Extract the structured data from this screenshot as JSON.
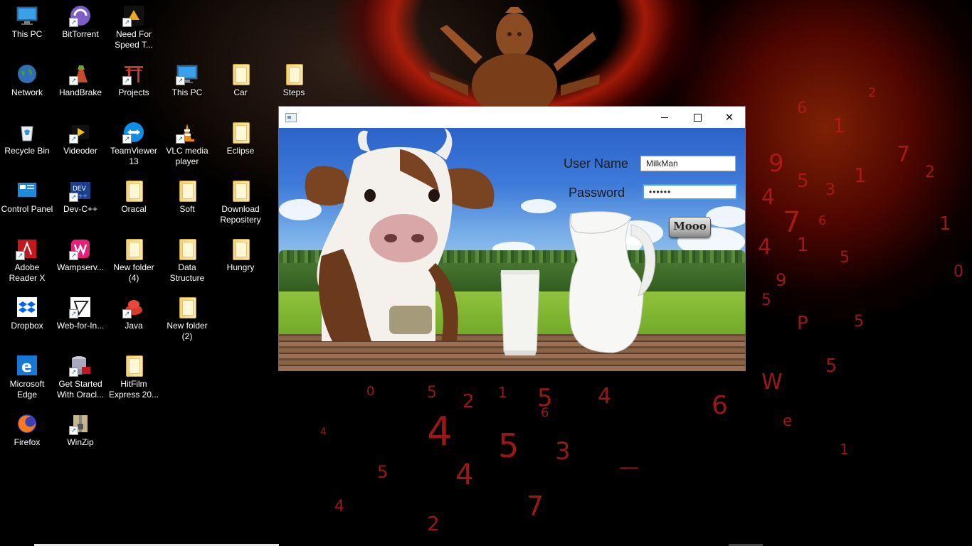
{
  "desktop": {
    "icons": [
      {
        "label": "This PC",
        "icon": "monitor-icon"
      },
      {
        "label": "BitTorrent",
        "icon": "bittorrent-icon"
      },
      {
        "label": "Need For Speed T...",
        "icon": "game-icon"
      },
      {
        "label": "Network",
        "icon": "globe-icon"
      },
      {
        "label": "HandBrake",
        "icon": "handbrake-icon"
      },
      {
        "label": "Projects",
        "icon": "torii-icon"
      },
      {
        "label": "This PC",
        "icon": "monitor-icon"
      },
      {
        "label": "Car",
        "icon": "folder-icon"
      },
      {
        "label": "Steps",
        "icon": "folder-icon"
      },
      {
        "label": "Recycle Bin",
        "icon": "recycle-bin-icon"
      },
      {
        "label": "Videoder",
        "icon": "videoder-icon"
      },
      {
        "label": "TeamViewer 13",
        "icon": "teamviewer-icon"
      },
      {
        "label": "VLC media player",
        "icon": "vlc-cone-icon"
      },
      {
        "label": "Eclipse",
        "icon": "folder-icon"
      },
      {
        "label": "Control Panel",
        "icon": "control-panel-icon"
      },
      {
        "label": "Dev-C++",
        "icon": "devcpp-icon"
      },
      {
        "label": "Oracal",
        "icon": "folder-icon"
      },
      {
        "label": "Soft",
        "icon": "folder-icon"
      },
      {
        "label": "Download Repositery",
        "icon": "folder-icon"
      },
      {
        "label": "Adobe Reader X",
        "icon": "adobe-reader-icon"
      },
      {
        "label": "Wampserv...",
        "icon": "wampserver-icon"
      },
      {
        "label": "New folder (4)",
        "icon": "folder-icon"
      },
      {
        "label": "Data Structure",
        "icon": "folder-icon"
      },
      {
        "label": "Hungry",
        "icon": "folder-icon"
      },
      {
        "label": "Dropbox",
        "icon": "dropbox-icon"
      },
      {
        "label": "Web-for-In...",
        "icon": "web-app-icon"
      },
      {
        "label": "Java",
        "icon": "java-icon"
      },
      {
        "label": "New folder (2)",
        "icon": "folder-icon"
      },
      {
        "label": "Microsoft Edge",
        "icon": "edge-icon"
      },
      {
        "label": "Get Started With Oracl...",
        "icon": "oracle-db-icon"
      },
      {
        "label": "HitFilm Express 20...",
        "icon": "folder-icon"
      },
      {
        "label": "Firefox",
        "icon": "firefox-icon"
      },
      {
        "label": "WinZip",
        "icon": "winzip-icon"
      }
    ]
  },
  "window": {
    "title": "",
    "controls": {
      "minimize": "minimize",
      "maximize": "maximize",
      "close": "✕"
    }
  },
  "login": {
    "username_label": "User Name",
    "username_value": "MilkMan",
    "password_label": "Password",
    "password_value": "••••••",
    "submit_label": "Mooo"
  },
  "colors": {
    "window_border": "#3b7bd4",
    "focus_border": "#4a9fe6"
  }
}
